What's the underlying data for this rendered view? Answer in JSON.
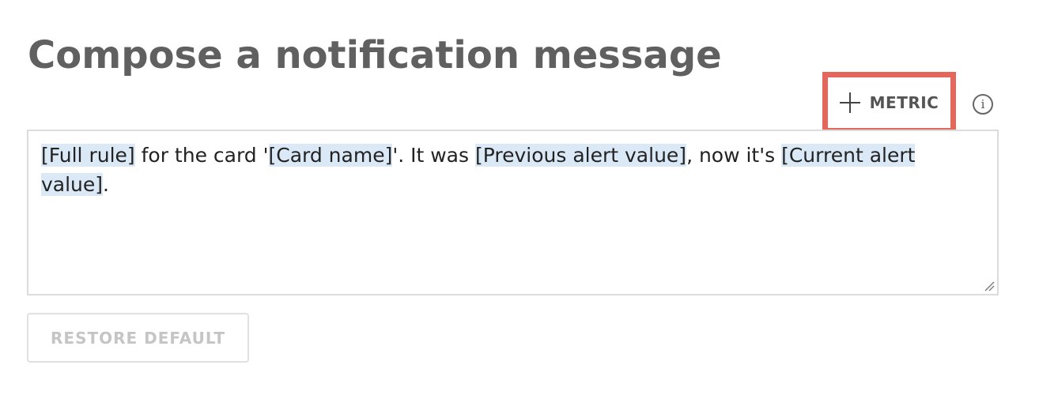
{
  "page": {
    "title": "Compose a notification message"
  },
  "toolbar": {
    "metric_label": "METRIC",
    "info_glyph": "i"
  },
  "editor": {
    "segments": [
      {
        "text": "[Full rule]",
        "token": true
      },
      {
        "text": " for the card '",
        "token": false
      },
      {
        "text": "[Card name]",
        "token": true
      },
      {
        "text": "'.  It was ",
        "token": false
      },
      {
        "text": "[Previous alert value]",
        "token": true
      },
      {
        "text": ", now it's ",
        "token": false
      },
      {
        "text": "[Current alert value]",
        "token": true
      },
      {
        "text": ".",
        "token": false
      }
    ]
  },
  "actions": {
    "restore_label": "RESTORE DEFAULT"
  },
  "colors": {
    "highlight_border": "#e5665a",
    "token_background": "#dbe9f7",
    "title_color": "#606060",
    "disabled_text": "#c5c5c5"
  },
  "icons": {
    "add": "plus-icon",
    "info": "info-icon",
    "resize": "resize-handle-icon"
  }
}
